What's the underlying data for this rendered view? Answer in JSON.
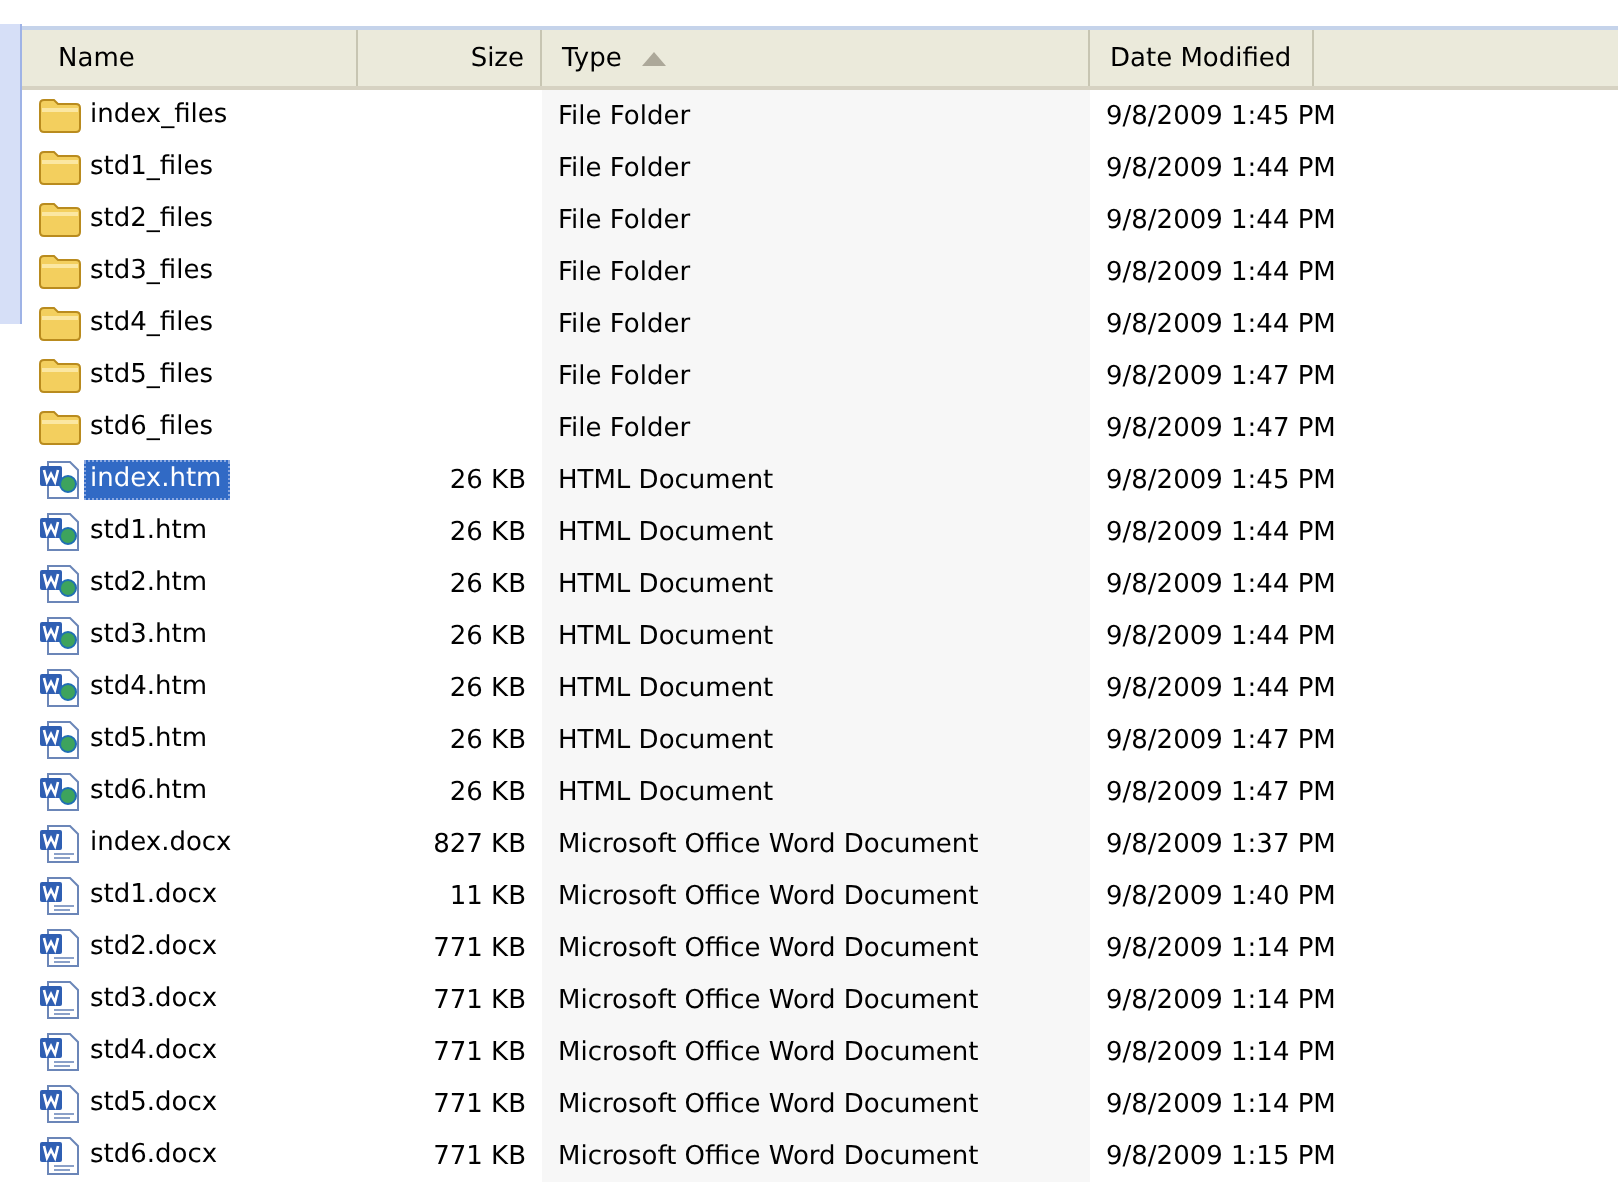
{
  "columns": [
    {
      "label": "Name",
      "sorted": false
    },
    {
      "label": "Size",
      "sorted": false
    },
    {
      "label": "Type",
      "sorted": true
    },
    {
      "label": "Date Modified",
      "sorted": false
    }
  ],
  "rows": [
    {
      "kind": "folder",
      "name": "index_files",
      "size": "",
      "type": "File Folder",
      "date": "9/8/2009 1:45 PM",
      "selected": false
    },
    {
      "kind": "folder",
      "name": "std1_files",
      "size": "",
      "type": "File Folder",
      "date": "9/8/2009 1:44 PM",
      "selected": false
    },
    {
      "kind": "folder",
      "name": "std2_files",
      "size": "",
      "type": "File Folder",
      "date": "9/8/2009 1:44 PM",
      "selected": false
    },
    {
      "kind": "folder",
      "name": "std3_files",
      "size": "",
      "type": "File Folder",
      "date": "9/8/2009 1:44 PM",
      "selected": false
    },
    {
      "kind": "folder",
      "name": "std4_files",
      "size": "",
      "type": "File Folder",
      "date": "9/8/2009 1:44 PM",
      "selected": false
    },
    {
      "kind": "folder",
      "name": "std5_files",
      "size": "",
      "type": "File Folder",
      "date": "9/8/2009 1:47 PM",
      "selected": false
    },
    {
      "kind": "folder",
      "name": "std6_files",
      "size": "",
      "type": "File Folder",
      "date": "9/8/2009 1:47 PM",
      "selected": false
    },
    {
      "kind": "htm",
      "name": "index.htm",
      "size": "26 KB",
      "type": "HTML Document",
      "date": "9/8/2009 1:45 PM",
      "selected": true
    },
    {
      "kind": "htm",
      "name": "std1.htm",
      "size": "26 KB",
      "type": "HTML Document",
      "date": "9/8/2009 1:44 PM",
      "selected": false
    },
    {
      "kind": "htm",
      "name": "std2.htm",
      "size": "26 KB",
      "type": "HTML Document",
      "date": "9/8/2009 1:44 PM",
      "selected": false
    },
    {
      "kind": "htm",
      "name": "std3.htm",
      "size": "26 KB",
      "type": "HTML Document",
      "date": "9/8/2009 1:44 PM",
      "selected": false
    },
    {
      "kind": "htm",
      "name": "std4.htm",
      "size": "26 KB",
      "type": "HTML Document",
      "date": "9/8/2009 1:44 PM",
      "selected": false
    },
    {
      "kind": "htm",
      "name": "std5.htm",
      "size": "26 KB",
      "type": "HTML Document",
      "date": "9/8/2009 1:47 PM",
      "selected": false
    },
    {
      "kind": "htm",
      "name": "std6.htm",
      "size": "26 KB",
      "type": "HTML Document",
      "date": "9/8/2009 1:47 PM",
      "selected": false
    },
    {
      "kind": "docx",
      "name": "index.docx",
      "size": "827 KB",
      "type": "Microsoft Office Word Document",
      "date": "9/8/2009 1:37 PM",
      "selected": false
    },
    {
      "kind": "docx",
      "name": "std1.docx",
      "size": "11 KB",
      "type": "Microsoft Office Word Document",
      "date": "9/8/2009 1:40 PM",
      "selected": false
    },
    {
      "kind": "docx",
      "name": "std2.docx",
      "size": "771 KB",
      "type": "Microsoft Office Word Document",
      "date": "9/8/2009 1:14 PM",
      "selected": false
    },
    {
      "kind": "docx",
      "name": "std3.docx",
      "size": "771 KB",
      "type": "Microsoft Office Word Document",
      "date": "9/8/2009 1:14 PM",
      "selected": false
    },
    {
      "kind": "docx",
      "name": "std4.docx",
      "size": "771 KB",
      "type": "Microsoft Office Word Document",
      "date": "9/8/2009 1:14 PM",
      "selected": false
    },
    {
      "kind": "docx",
      "name": "std5.docx",
      "size": "771 KB",
      "type": "Microsoft Office Word Document",
      "date": "9/8/2009 1:14 PM",
      "selected": false
    },
    {
      "kind": "docx",
      "name": "std6.docx",
      "size": "771 KB",
      "type": "Microsoft Office Word Document",
      "date": "9/8/2009 1:15 PM",
      "selected": false
    }
  ]
}
